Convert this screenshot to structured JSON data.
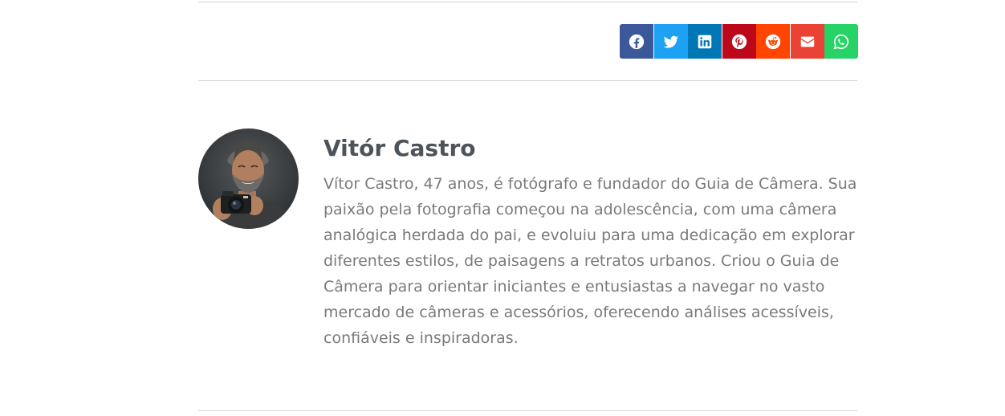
{
  "share": {
    "buttons": [
      {
        "id": "facebook",
        "icon": "facebook-icon",
        "color": "#3b5998"
      },
      {
        "id": "twitter",
        "icon": "twitter-icon",
        "color": "#1da1f2"
      },
      {
        "id": "linkedin",
        "icon": "linkedin-icon",
        "color": "#0077b5"
      },
      {
        "id": "pinterest",
        "icon": "pinterest-icon",
        "color": "#bd081c"
      },
      {
        "id": "reddit",
        "icon": "reddit-icon",
        "color": "#ff4500"
      },
      {
        "id": "email",
        "icon": "envelope-icon",
        "color": "#ea4335"
      },
      {
        "id": "whatsapp",
        "icon": "whatsapp-icon",
        "color": "#25d366"
      }
    ]
  },
  "author": {
    "name": "Vitór Castro",
    "bio": "Vítor Castro, 47 anos, é fotógrafo e fundador do Guia de Câmera. Sua paixão pela fotografia começou na adolescência, com uma câmera analógica herdada do pai, e evoluiu para uma dedicação em explorar diferentes estilos, de paisagens a retratos urbanos. Criou o Guia de Câmera para orientar iniciantes e entusiastas a navegar no vasto mercado de câmeras e acessórios, oferecendo análises acessíveis, confiáveis e inspiradoras."
  },
  "colors": {
    "divider": "#d4d4d4",
    "name": "#4d535a",
    "bio": "#7a7a7a"
  }
}
